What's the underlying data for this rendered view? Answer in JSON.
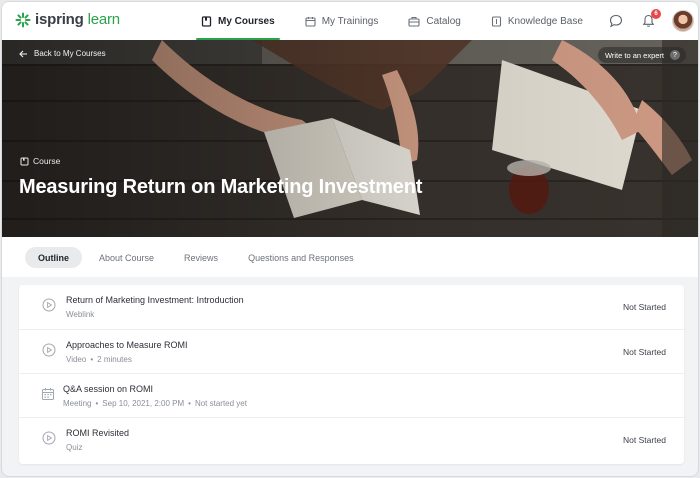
{
  "brand": {
    "name_bold": "ispring",
    "name_light": "learn"
  },
  "nav": [
    {
      "label": "My Courses",
      "icon": "book-icon",
      "active": true
    },
    {
      "label": "My Trainings",
      "icon": "calendar-icon",
      "active": false
    },
    {
      "label": "Catalog",
      "icon": "briefcase-icon",
      "active": false
    },
    {
      "label": "Knowledge Base",
      "icon": "knowledge-icon",
      "active": false
    }
  ],
  "topbar": {
    "notification_count": "6"
  },
  "hero": {
    "back_label": "Back to My Courses",
    "expert_label": "Write to an expert",
    "expert_hint": "?",
    "type_label": "Course",
    "title": "Measuring Return on Marketing Investment"
  },
  "tabs": [
    {
      "label": "Outline",
      "active": true
    },
    {
      "label": "About Course",
      "active": false
    },
    {
      "label": "Reviews",
      "active": false
    },
    {
      "label": "Questions and Responses",
      "active": false
    }
  ],
  "items": [
    {
      "title": "Return of Marketing Investment: Introduction",
      "meta": [
        "Weblink"
      ],
      "status": "Not Started",
      "icon": "play-circle-icon"
    },
    {
      "title": "Approaches to Measure ROMI",
      "meta": [
        "Video",
        "2 minutes"
      ],
      "status": "Not Started",
      "icon": "play-circle-icon"
    },
    {
      "title": "Q&A session on ROMI",
      "meta": [
        "Meeting",
        "Sep 10, 2021, 2:00 PM",
        "Not started yet"
      ],
      "status": "",
      "icon": "calendar-icon"
    },
    {
      "title": "ROMI Revisited",
      "meta": [
        "Quiz"
      ],
      "status": "Not Started",
      "icon": "play-circle-icon"
    }
  ],
  "colors": {
    "accent": "#2ba24c",
    "badge": "#e5484d"
  }
}
